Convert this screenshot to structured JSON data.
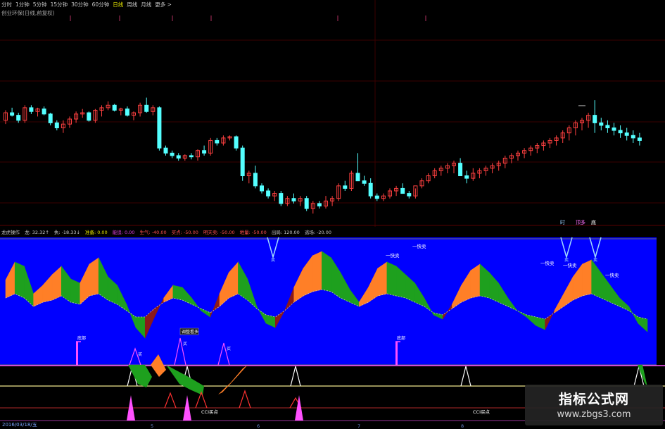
{
  "toolbar": {
    "items": [
      "分时",
      "1分钟",
      "5分钟",
      "15分钟",
      "30分钟",
      "60分钟",
      "日线",
      "周线",
      "月线",
      "更多 >"
    ],
    "active": "日线"
  },
  "subtitle": "创业环保(日线,前复权)",
  "indicator_legend": [
    {
      "text": "龙虎操作",
      "color": "#c8c8c8"
    },
    {
      "text": "龙: 32.32↑",
      "color": "#c8c8c8"
    },
    {
      "text": "执: -18.33↓",
      "color": "#c8c8c8"
    },
    {
      "text": "准备: 0.00",
      "color": "#e0e000"
    },
    {
      "text": "能追: 0.00",
      "color": "#e040e0"
    },
    {
      "text": "生气: -40.00",
      "color": "#ff5050"
    },
    {
      "text": "买点: -50.00",
      "color": "#ff5050"
    },
    {
      "text": "明天卖: -50.00",
      "color": "#ff5050"
    },
    {
      "text": "地量: -50.00",
      "color": "#ff5050"
    },
    {
      "text": "出局: 120.00",
      "color": "#c8c8c8"
    },
    {
      "text": "逃场: -20.00",
      "color": "#c8c8c8"
    }
  ],
  "price_markers": [
    "时",
    "顶多",
    "底"
  ],
  "annotations": {
    "sell_signal": "卖",
    "quick_sell": "一快卖",
    "buy_signal": "底部",
    "adjust": "调整看多",
    "buy_ready": "买",
    "cci_buy": "CCI买点",
    "cci_buy_2": "CCI买点"
  },
  "date_label": "2016/03/18/五",
  "x_ticks": [
    "5",
    "6",
    "7",
    "8"
  ],
  "watermark": {
    "title": "指标公式网",
    "url": "www.zbgs3.com"
  },
  "colors": {
    "up_candle": "#ff4040",
    "down_candle": "#54ffff",
    "indicator_bg": "#0000ff",
    "orange_band": "#ff7f27",
    "green_band": "#1ea01e",
    "red_band": "#8b1a1a",
    "magenta": "#ff50ff",
    "yellow_line": "#f0e68c",
    "white_line": "#ffffff"
  },
  "chart_data": [
    {
      "type": "candlestick",
      "panel": "price",
      "x_count": 100,
      "ohlc": [
        [
          30,
          38,
          27,
          36
        ],
        [
          36,
          40,
          33,
          34
        ],
        [
          34,
          36,
          28,
          30
        ],
        [
          30,
          42,
          28,
          40
        ],
        [
          40,
          42,
          35,
          37
        ],
        [
          37,
          40,
          33,
          39
        ],
        [
          39,
          41,
          34,
          35
        ],
        [
          35,
          36,
          26,
          28
        ],
        [
          28,
          30,
          22,
          24
        ],
        [
          24,
          30,
          20,
          27
        ],
        [
          27,
          33,
          24,
          31
        ],
        [
          31,
          37,
          28,
          35
        ],
        [
          35,
          39,
          32,
          36
        ],
        [
          36,
          37,
          29,
          30
        ],
        [
          30,
          39,
          28,
          38
        ],
        [
          38,
          42,
          33,
          40
        ],
        [
          40,
          45,
          38,
          42
        ],
        [
          42,
          43,
          37,
          38
        ],
        [
          38,
          40,
          34,
          39
        ],
        [
          39,
          41,
          33,
          34
        ],
        [
          34,
          37,
          30,
          36
        ],
        [
          36,
          44,
          33,
          42
        ],
        [
          42,
          48,
          36,
          37
        ],
        [
          37,
          42,
          34,
          40
        ],
        [
          40,
          41,
          6,
          8
        ],
        [
          8,
          10,
          2,
          4
        ],
        [
          4,
          6,
          0,
          2
        ],
        [
          2,
          4,
          -2,
          0
        ],
        [
          0,
          3,
          -2,
          2
        ],
        [
          2,
          4,
          -1,
          1
        ],
        [
          1,
          7,
          -2,
          6
        ],
        [
          6,
          10,
          2,
          4
        ],
        [
          4,
          16,
          2,
          14
        ],
        [
          14,
          16,
          10,
          12
        ],
        [
          12,
          18,
          10,
          16
        ],
        [
          16,
          18,
          14,
          17
        ],
        [
          17,
          18,
          6,
          8
        ],
        [
          8,
          10,
          -18,
          -14
        ],
        [
          -14,
          -10,
          -20,
          -12
        ],
        [
          -12,
          -6,
          -24,
          -22
        ],
        [
          -22,
          -20,
          -28,
          -26
        ],
        [
          -26,
          -24,
          -32,
          -30
        ],
        [
          -30,
          -26,
          -34,
          -28
        ],
        [
          -28,
          -26,
          -38,
          -36
        ],
        [
          -36,
          -30,
          -38,
          -32
        ],
        [
          -32,
          -28,
          -36,
          -34
        ],
        [
          -34,
          -30,
          -38,
          -32
        ],
        [
          -32,
          -30,
          -42,
          -40
        ],
        [
          -40,
          -34,
          -44,
          -36
        ],
        [
          -36,
          -34,
          -40,
          -38
        ],
        [
          -38,
          -30,
          -40,
          -34
        ],
        [
          -34,
          -30,
          -38,
          -32
        ],
        [
          -32,
          -20,
          -34,
          -22
        ],
        [
          -22,
          -18,
          -26,
          -24
        ],
        [
          -24,
          -10,
          -26,
          -12
        ],
        [
          -12,
          4,
          -14,
          -18
        ],
        [
          -18,
          -14,
          -22,
          -20
        ],
        [
          -20,
          -16,
          -32,
          -30
        ],
        [
          -30,
          -28,
          -34,
          -32
        ],
        [
          -32,
          -28,
          -34,
          -30
        ],
        [
          -30,
          -24,
          -32,
          -26
        ],
        [
          -26,
          -22,
          -30,
          -24
        ],
        [
          -24,
          -20,
          -28,
          -28
        ],
        [
          -28,
          -26,
          -32,
          -30
        ],
        [
          -30,
          -24,
          -32,
          -22
        ],
        [
          -22,
          -16,
          -24,
          -18
        ],
        [
          -18,
          -12,
          -20,
          -14
        ],
        [
          -14,
          -8,
          -16,
          -10
        ],
        [
          -10,
          -6,
          -14,
          -8
        ],
        [
          -8,
          -4,
          -12,
          -6
        ],
        [
          -6,
          -2,
          -12,
          -4
        ],
        [
          -4,
          0,
          -10,
          -14
        ],
        [
          -14,
          -10,
          -20,
          -16
        ],
        [
          -16,
          -8,
          -18,
          -12
        ],
        [
          -12,
          -8,
          -16,
          -10
        ],
        [
          -10,
          -6,
          -14,
          -8
        ],
        [
          -8,
          -4,
          -12,
          -6
        ],
        [
          -6,
          -2,
          -10,
          -4
        ],
        [
          -4,
          2,
          -8,
          0
        ],
        [
          0,
          4,
          -4,
          2
        ],
        [
          2,
          6,
          -2,
          4
        ],
        [
          4,
          8,
          0,
          6
        ],
        [
          6,
          10,
          2,
          8
        ],
        [
          8,
          12,
          4,
          10
        ],
        [
          10,
          14,
          6,
          12
        ],
        [
          12,
          16,
          8,
          14
        ],
        [
          14,
          18,
          10,
          16
        ],
        [
          16,
          22,
          12,
          20
        ],
        [
          20,
          26,
          14,
          24
        ],
        [
          24,
          30,
          18,
          28
        ],
        [
          28,
          32,
          22,
          30
        ],
        [
          30,
          36,
          24,
          34
        ],
        [
          34,
          46,
          20,
          28
        ],
        [
          28,
          32,
          22,
          26
        ],
        [
          26,
          30,
          20,
          24
        ],
        [
          24,
          28,
          18,
          22
        ],
        [
          22,
          26,
          16,
          20
        ],
        [
          20,
          24,
          14,
          18
        ],
        [
          18,
          22,
          12,
          16
        ],
        [
          16,
          20,
          10,
          14
        ]
      ],
      "ylim": [
        -45,
        50
      ]
    },
    {
      "type": "area",
      "panel": "indicator",
      "series": [
        {
          "values": [
            0.65,
            0.82,
            0.78,
            0.52,
            0.6,
            0.7,
            0.78,
            0.66,
            0.62,
            0.8,
            0.86,
            0.68,
            0.6,
            0.42,
            0.2,
            0.1,
            0.3,
            0.48,
            0.6,
            0.58,
            0.48,
            0.36,
            0.3,
            0.52,
            0.72,
            0.82,
            0.66,
            0.4,
            0.24,
            0.2,
            0.36,
            0.58,
            0.76,
            0.88,
            0.92,
            0.86,
            0.72,
            0.56,
            0.44,
            0.58,
            0.76,
            0.82,
            0.78,
            0.7,
            0.62,
            0.48,
            0.32,
            0.28,
            0.42,
            0.6,
            0.74,
            0.8,
            0.72,
            0.62,
            0.48,
            0.36,
            0.3,
            0.22,
            0.18,
            0.36,
            0.52,
            0.68,
            0.8,
            0.84,
            0.72,
            0.6,
            0.48,
            0.4,
            0.24,
            0.16
          ]
        },
        {
          "values": [
            0.48,
            0.52,
            0.48,
            0.4,
            0.44,
            0.46,
            0.5,
            0.44,
            0.42,
            0.5,
            0.52,
            0.46,
            0.42,
            0.36,
            0.3,
            0.3,
            0.38,
            0.44,
            0.48,
            0.46,
            0.42,
            0.38,
            0.34,
            0.4,
            0.48,
            0.52,
            0.46,
            0.38,
            0.32,
            0.3,
            0.36,
            0.44,
            0.5,
            0.54,
            0.56,
            0.54,
            0.48,
            0.44,
            0.4,
            0.44,
            0.5,
            0.52,
            0.5,
            0.48,
            0.44,
            0.4,
            0.34,
            0.32,
            0.38,
            0.44,
            0.48,
            0.5,
            0.48,
            0.44,
            0.4,
            0.36,
            0.32,
            0.3,
            0.28,
            0.34,
            0.4,
            0.46,
            0.5,
            0.52,
            0.48,
            0.44,
            0.4,
            0.36,
            0.3,
            0.28
          ]
        }
      ],
      "ylim": [
        0,
        1
      ]
    }
  ]
}
